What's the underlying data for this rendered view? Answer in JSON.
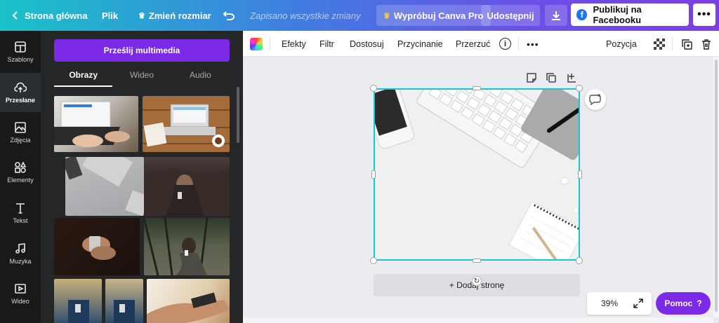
{
  "topbar": {
    "home": "Strona główna",
    "file": "Plik",
    "resize": "Zmień rozmiar",
    "saved": "Zapisano wszystkie zmiany",
    "try_pro": "Wypróbuj Canva Pro",
    "share": "Udostępnij",
    "publish": "Publikuj na Facebooku",
    "icons": [
      "chevron-left-icon",
      "crown-icon",
      "undo-icon",
      "download-icon",
      "facebook-icon",
      "more-icon"
    ]
  },
  "rail": [
    {
      "label": "Szablony",
      "icon": "templates-icon"
    },
    {
      "label": "Przesłane",
      "icon": "upload-cloud-icon",
      "active": true
    },
    {
      "label": "Zdjęcia",
      "icon": "photo-icon"
    },
    {
      "label": "Elementy",
      "icon": "shapes-icon"
    },
    {
      "label": "Tekst",
      "icon": "text-icon"
    },
    {
      "label": "Muzyka",
      "icon": "music-icon"
    },
    {
      "label": "Wideo",
      "icon": "video-icon"
    }
  ],
  "panel": {
    "upload_button": "Prześlij multimedia",
    "tabs": [
      "Obrazy",
      "Wideo",
      "Audio"
    ],
    "active_tab": "Obrazy"
  },
  "toolbar": {
    "effects": "Efekty",
    "filter": "Filtr",
    "adjust": "Dostosuj",
    "crop": "Przycinanie",
    "flip": "Przerzuć",
    "position": "Pozycja"
  },
  "canvas": {
    "add_page": "+ Dodaj stronę"
  },
  "footer": {
    "zoom": "39%",
    "help": "Pomoc",
    "help_icon": "?"
  },
  "colors": {
    "accent": "#7d2ae8",
    "selection": "#18c6d2"
  }
}
